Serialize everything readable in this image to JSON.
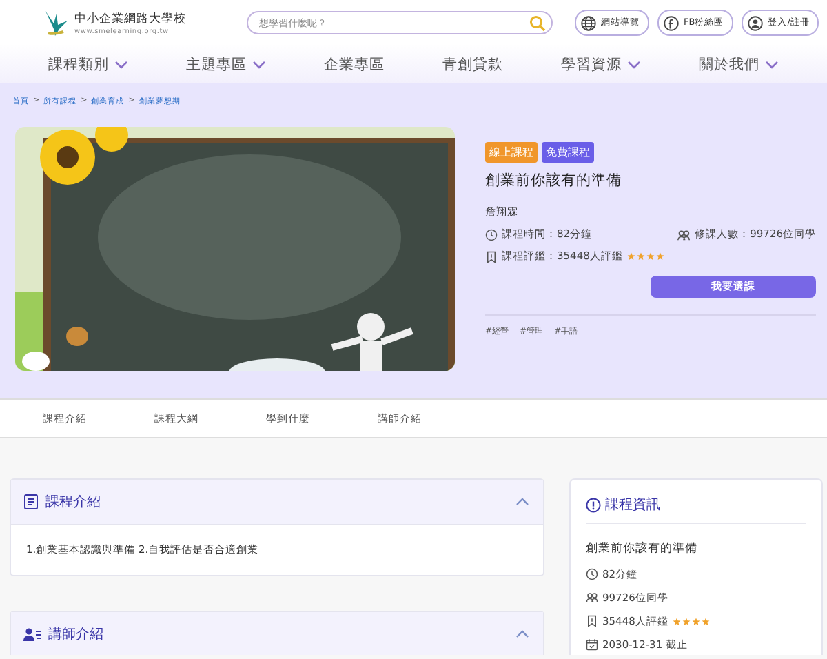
{
  "header": {
    "logo_title": "中小企業網路大學校",
    "logo_url": "www.smelearning.org.tw",
    "search": {
      "placeholder": "想學習什麼呢？"
    },
    "links": [
      {
        "kind": "globe",
        "label": "網站導覽"
      },
      {
        "kind": "facebook",
        "label": "FB粉絲團"
      },
      {
        "kind": "user",
        "label": "登入/註冊"
      }
    ]
  },
  "nav": [
    {
      "label": "課程類別",
      "dropdown": true
    },
    {
      "label": "主題專區",
      "dropdown": true
    },
    {
      "label": "企業專區",
      "dropdown": false
    },
    {
      "label": "青創貸款",
      "dropdown": false
    },
    {
      "label": "學習資源",
      "dropdown": true
    },
    {
      "label": "關於我們",
      "dropdown": true
    }
  ],
  "breadcrumb": [
    {
      "kind": "link",
      "text": "首頁"
    },
    {
      "kind": "separator",
      "text": ">"
    },
    {
      "kind": "link",
      "text": "所有課程"
    },
    {
      "kind": "separator",
      "text": ">"
    },
    {
      "kind": "link",
      "text": "創業育成"
    },
    {
      "kind": "separator",
      "text": ">"
    },
    {
      "kind": "link",
      "text": "創業夢想期"
    }
  ],
  "course": {
    "badges": [
      {
        "label": "線上課程",
        "color": "#f0962b"
      },
      {
        "label": "免費課程",
        "color": "#6a5ee8"
      }
    ],
    "title": "創業前你該有的準備",
    "teacher": "詹翔霖",
    "duration": "課程時間：82分鐘",
    "students": "修課人數：99726位同學",
    "rating": "課程評鑑：35448人評鑑",
    "stars": 4,
    "enroll": "我要選課",
    "tags": [
      "#經營",
      "#管理",
      "#手語"
    ]
  },
  "tabs": [
    {
      "label": "課程介紹"
    },
    {
      "label": "課程大綱"
    },
    {
      "label": "學到什麼"
    },
    {
      "label": "講師介紹"
    }
  ],
  "sections": [
    {
      "kind": "intro",
      "title": "課程介紹",
      "expanded": true,
      "body": "1.創業基本認識與準備 2.自我評估是否合適創業"
    },
    {
      "kind": "teacher",
      "title": "講師介紹",
      "expanded": true
    }
  ],
  "info": {
    "title": "課程資訊",
    "name": "創業前你該有的準備",
    "rows": [
      {
        "kind": "time",
        "text": "82分鐘"
      },
      {
        "kind": "people",
        "text": "99726位同學"
      },
      {
        "kind": "rating",
        "text": "35448人評鑑",
        "stars": 4
      },
      {
        "kind": "date",
        "text": "2030-12-31 截止"
      }
    ]
  }
}
